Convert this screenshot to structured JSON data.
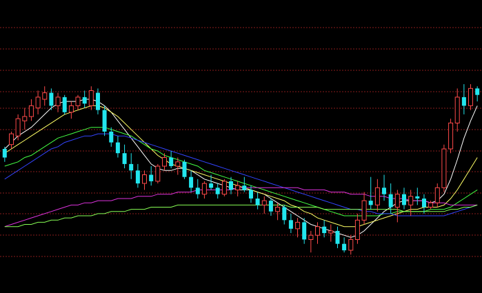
{
  "colors": {
    "background": "#000000",
    "grid": "#8a1c1c",
    "up": "#ff4a4a",
    "down": "#22e6ee"
  },
  "chart_data": {
    "type": "candlestick",
    "title": "",
    "xlabel": "",
    "ylabel": "",
    "grid": true,
    "grid_style": "dashed horizontal",
    "ylim": [
      0,
      100
    ],
    "ohlc": [
      [
        54,
        55,
        48,
        50
      ],
      [
        56,
        62,
        54,
        61
      ],
      [
        60,
        70,
        58,
        68
      ],
      [
        67,
        73,
        63,
        69
      ],
      [
        69,
        77,
        67,
        74
      ],
      [
        73,
        81,
        70,
        78
      ],
      [
        77,
        83,
        74,
        80
      ],
      [
        80,
        82,
        72,
        74
      ],
      [
        74,
        80,
        71,
        78
      ],
      [
        78,
        79,
        70,
        71
      ],
      [
        71,
        76,
        68,
        74
      ],
      [
        74,
        79,
        72,
        78
      ],
      [
        78,
        81,
        73,
        75
      ],
      [
        74,
        83,
        72,
        81
      ],
      [
        80,
        82,
        70,
        72
      ],
      [
        72,
        74,
        60,
        62
      ],
      [
        62,
        64,
        55,
        57
      ],
      [
        57,
        60,
        50,
        52
      ],
      [
        52,
        56,
        45,
        47
      ],
      [
        47,
        52,
        40,
        44
      ],
      [
        44,
        47,
        36,
        38
      ],
      [
        38,
        44,
        35,
        42
      ],
      [
        42,
        46,
        37,
        39
      ],
      [
        39,
        47,
        38,
        46
      ],
      [
        46,
        52,
        44,
        50
      ],
      [
        50,
        53,
        45,
        46
      ],
      [
        46,
        50,
        42,
        48
      ],
      [
        48,
        49,
        40,
        41
      ],
      [
        41,
        44,
        34,
        36
      ],
      [
        36,
        40,
        31,
        33
      ],
      [
        33,
        39,
        31,
        38
      ],
      [
        38,
        42,
        35,
        36
      ],
      [
        36,
        38,
        31,
        33
      ],
      [
        33,
        40,
        32,
        39
      ],
      [
        39,
        41,
        33,
        35
      ],
      [
        35,
        39,
        32,
        37
      ],
      [
        37,
        41,
        34,
        35
      ],
      [
        35,
        37,
        29,
        31
      ],
      [
        31,
        34,
        26,
        28
      ],
      [
        28,
        32,
        24,
        30
      ],
      [
        30,
        31,
        23,
        25
      ],
      [
        25,
        29,
        21,
        27
      ],
      [
        27,
        28,
        19,
        21
      ],
      [
        21,
        24,
        15,
        17
      ],
      [
        17,
        22,
        13,
        20
      ],
      [
        20,
        22,
        10,
        12
      ],
      [
        12,
        16,
        6,
        14
      ],
      [
        14,
        20,
        10,
        18
      ],
      [
        18,
        21,
        13,
        15
      ],
      [
        15,
        19,
        11,
        16
      ],
      [
        16,
        18,
        8,
        10
      ],
      [
        10,
        13,
        6,
        7
      ],
      [
        7,
        14,
        5,
        12
      ],
      [
        12,
        24,
        10,
        21
      ],
      [
        21,
        34,
        19,
        30
      ],
      [
        30,
        41,
        26,
        28
      ],
      [
        28,
        40,
        25,
        36
      ],
      [
        36,
        42,
        30,
        33
      ],
      [
        33,
        38,
        24,
        27
      ],
      [
        27,
        35,
        20,
        33
      ],
      [
        33,
        36,
        26,
        28
      ],
      [
        28,
        35,
        23,
        32
      ],
      [
        32,
        36,
        28,
        31
      ],
      [
        31,
        33,
        24,
        27
      ],
      [
        27,
        30,
        26,
        29
      ],
      [
        29,
        38,
        27,
        36
      ],
      [
        36,
        56,
        34,
        54
      ],
      [
        54,
        68,
        52,
        66
      ],
      [
        66,
        82,
        62,
        78
      ],
      [
        78,
        84,
        70,
        74
      ],
      [
        74,
        84,
        72,
        82
      ],
      [
        82,
        83,
        76,
        79
      ]
    ],
    "moving_averages": [
      {
        "color": "#ffffff",
        "values": [
          54,
          57,
          60,
          62,
          64,
          67,
          70,
          73,
          75,
          76,
          76,
          76,
          77,
          77,
          76,
          74,
          71,
          67,
          63,
          59,
          55,
          51,
          47,
          45,
          44,
          44,
          45,
          45,
          44,
          42,
          40,
          39,
          38,
          37,
          36,
          35,
          35,
          35,
          34,
          33,
          31,
          29,
          27,
          25,
          23,
          21,
          19,
          18,
          17,
          16,
          15,
          14,
          13,
          14,
          16,
          19,
          22,
          25,
          27,
          29,
          30,
          30,
          30,
          30,
          29,
          30,
          33,
          40,
          49,
          59,
          67,
          74
        ]
      },
      {
        "color": "#ffff66",
        "values": [
          52,
          54,
          56,
          58,
          60,
          62,
          64,
          66,
          68,
          70,
          71,
          72,
          73,
          74,
          74,
          73,
          71,
          69,
          66,
          63,
          60,
          57,
          54,
          51,
          49,
          47,
          46,
          45,
          44,
          43,
          42,
          41,
          40,
          39,
          38,
          37,
          36,
          35,
          34,
          33,
          32,
          31,
          30,
          28,
          27,
          25,
          24,
          22,
          21,
          20,
          19,
          18,
          18,
          18,
          19,
          20,
          21,
          22,
          23,
          24,
          25,
          26,
          26,
          27,
          27,
          27,
          28,
          31,
          35,
          40,
          45,
          50
        ]
      },
      {
        "color": "#44ff44",
        "values": [
          46,
          47,
          48,
          50,
          51,
          53,
          55,
          57,
          59,
          60,
          61,
          62,
          63,
          64,
          64,
          64,
          63,
          62,
          61,
          60,
          58,
          56,
          54,
          53,
          51,
          50,
          49,
          48,
          47,
          46,
          44,
          43,
          42,
          41,
          40,
          39,
          38,
          37,
          36,
          35,
          34,
          33,
          32,
          31,
          30,
          29,
          28,
          27,
          26,
          25,
          24,
          23,
          23,
          23,
          23,
          23,
          23,
          24,
          24,
          25,
          25,
          25,
          25,
          25,
          26,
          26,
          26,
          27,
          29,
          31,
          33,
          35
        ]
      },
      {
        "color": "#3344ff",
        "values": [
          40,
          42,
          44,
          46,
          48,
          50,
          52,
          54,
          55,
          57,
          58,
          59,
          60,
          60,
          61,
          61,
          61,
          60,
          60,
          59,
          58,
          57,
          56,
          55,
          54,
          53,
          52,
          51,
          50,
          49,
          48,
          47,
          46,
          45,
          44,
          43,
          42,
          41,
          40,
          39,
          38,
          37,
          36,
          35,
          34,
          33,
          32,
          31,
          30,
          29,
          28,
          27,
          26,
          26,
          25,
          25,
          24,
          24,
          24,
          23,
          23,
          23,
          23,
          23,
          23,
          23,
          23,
          24,
          25,
          26,
          27,
          28
        ]
      },
      {
        "color": "#dd33dd",
        "values": [
          18,
          19,
          20,
          21,
          22,
          23,
          24,
          25,
          26,
          27,
          28,
          28,
          29,
          29,
          30,
          30,
          30,
          31,
          31,
          31,
          32,
          32,
          32,
          33,
          33,
          33,
          34,
          34,
          34,
          35,
          35,
          35,
          35,
          35,
          35,
          36,
          36,
          36,
          36,
          36,
          36,
          36,
          36,
          36,
          36,
          35,
          35,
          35,
          35,
          34,
          34,
          34,
          33,
          33,
          33,
          32,
          32,
          32,
          31,
          31,
          31,
          30,
          30,
          30,
          29,
          29,
          29,
          28,
          28,
          28,
          28,
          28
        ]
      },
      {
        "color": "#88ff55",
        "values": [
          18,
          18,
          18,
          19,
          19,
          20,
          20,
          21,
          21,
          22,
          22,
          23,
          23,
          23,
          24,
          24,
          25,
          25,
          25,
          26,
          26,
          26,
          27,
          27,
          27,
          27,
          28,
          28,
          28,
          28,
          28,
          28,
          28,
          28,
          28,
          28,
          28,
          28,
          28,
          28,
          28,
          28,
          28,
          27,
          27,
          27,
          27,
          27,
          26,
          26,
          26,
          26,
          26,
          26,
          26,
          26,
          26,
          26,
          26,
          26,
          25,
          25,
          25,
          25,
          25,
          25,
          25,
          26,
          26,
          27,
          27,
          28
        ]
      }
    ]
  }
}
